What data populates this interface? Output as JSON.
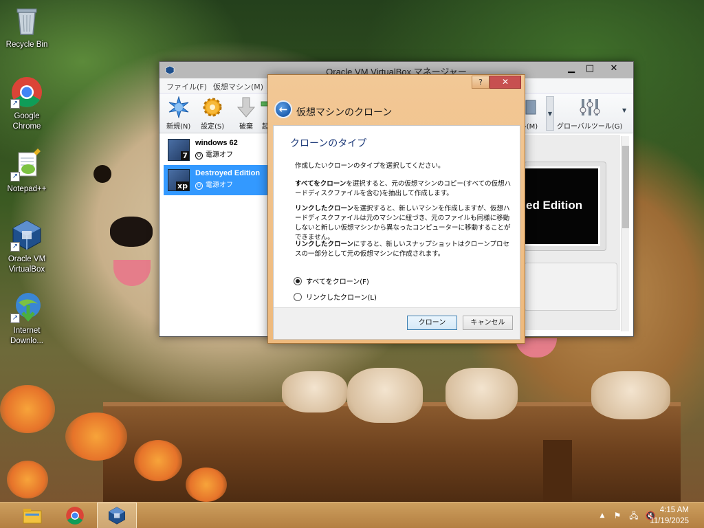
{
  "desktop": {
    "icons": [
      {
        "label": "Recycle Bin",
        "icon": "recycle-bin-icon"
      },
      {
        "label": "Google\nChrome",
        "icon": "chrome-icon"
      },
      {
        "label": "Notepad++",
        "icon": "notepad-plus-plus-icon"
      },
      {
        "label": "Oracle VM\nVirtualBox",
        "icon": "virtualbox-icon"
      },
      {
        "label": "Internet\nDownlo...",
        "icon": "internet-download-manager-icon"
      }
    ]
  },
  "vbox": {
    "title": "Oracle VM VirtualBox マネージャー",
    "menu": [
      "ファイル(F)",
      "仮想マシン(M)"
    ],
    "toolbar": {
      "new": "新規(N)",
      "settings": "設定(S)",
      "discard": "破棄",
      "start": "起",
      "machine_tools": "ル(M)",
      "global_tools": "グローバルツール(G)"
    },
    "vms": [
      {
        "name": "windows 62",
        "state": "電源オフ",
        "os_badge": "7"
      },
      {
        "name": "Destroyed Edition",
        "state": "電源オフ",
        "os_badge": "xp"
      }
    ],
    "preview_text": "ed Edition"
  },
  "dialog": {
    "help": "?",
    "close": "✕",
    "title": "仮想マシンのクローン",
    "heading": "クローンのタイプ",
    "intro": "作成したいクローンのタイプを選択してください。",
    "full_clone_bold": "すべてをクローン",
    "full_clone_text": "を選択すると、元の仮想マシンのコピー(すべての仮想ハードディスクファイルを含む)を抽出して作成します。",
    "linked_clone_bold": "リンクしたクローン",
    "linked_clone_text": "を選択すると、新しいマシンを作成しますが、仮想ハードディスクファイルは元のマシンに紐づき、元のファイルも同様に移動しないと新しい仮想マシンから異なったコンピューターに移動することができません。",
    "snapshot_bold": "リンクしたクローン",
    "snapshot_text": "にすると、新しいスナップショットはクローンプロセスの一部分として元の仮想マシンに作成されます。",
    "options": [
      {
        "label": "すべてをクローン(F)",
        "checked": true
      },
      {
        "label": "リンクしたクローン(L)",
        "checked": false
      }
    ],
    "clone_button": "クローン",
    "cancel_button": "キャンセル"
  },
  "taskbar": {
    "apps": [
      "file-explorer-icon",
      "chrome-icon",
      "virtualbox-icon"
    ],
    "time": "4:15 AM",
    "date": "11/19/2025"
  }
}
